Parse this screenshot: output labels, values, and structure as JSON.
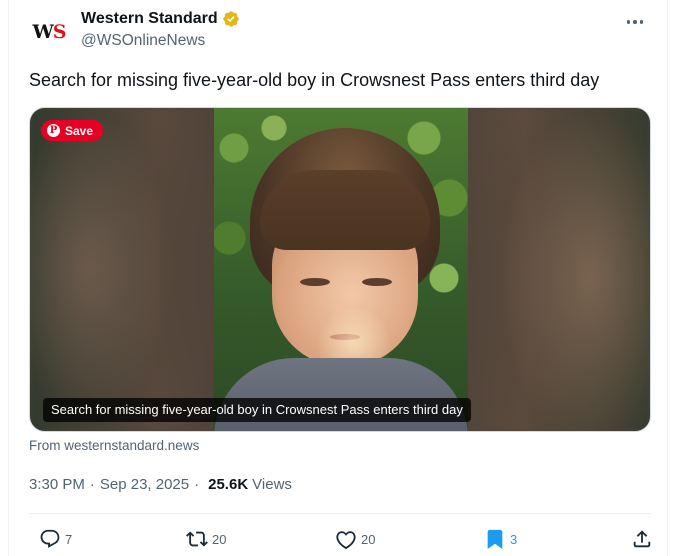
{
  "account": {
    "display_name": "Western Standard",
    "handle": "@WSOnlineNews",
    "avatar_text_w": "W",
    "avatar_text_s": "S"
  },
  "tweet": {
    "text": "Search for missing five-year-old boy in Crowsnest Pass enters third day"
  },
  "media": {
    "save_label": "Save",
    "caption": "Search for missing five-year-old boy in Crowsnest Pass enters third day"
  },
  "source": "From westernstandard.news",
  "meta": {
    "time": "3:30 PM",
    "date": "Sep 23, 2025",
    "separator": "·",
    "views_count": "25.6K",
    "views_label": "Views"
  },
  "actions": {
    "reply_count": "7",
    "retweet_count": "20",
    "like_count": "20",
    "bookmark_count": "3"
  },
  "colors": {
    "text_primary": "#0f1419",
    "text_secondary": "#536471",
    "accent_blue": "#1d9bf0",
    "verified_gold": "#e2b719",
    "pinterest_red": "#e60023"
  },
  "icons": {
    "verified": "verified-badge-icon",
    "more": "more-options-icon",
    "reply": "reply-icon",
    "retweet": "retweet-icon",
    "like": "heart-icon",
    "bookmark": "bookmark-icon",
    "share": "share-icon"
  }
}
